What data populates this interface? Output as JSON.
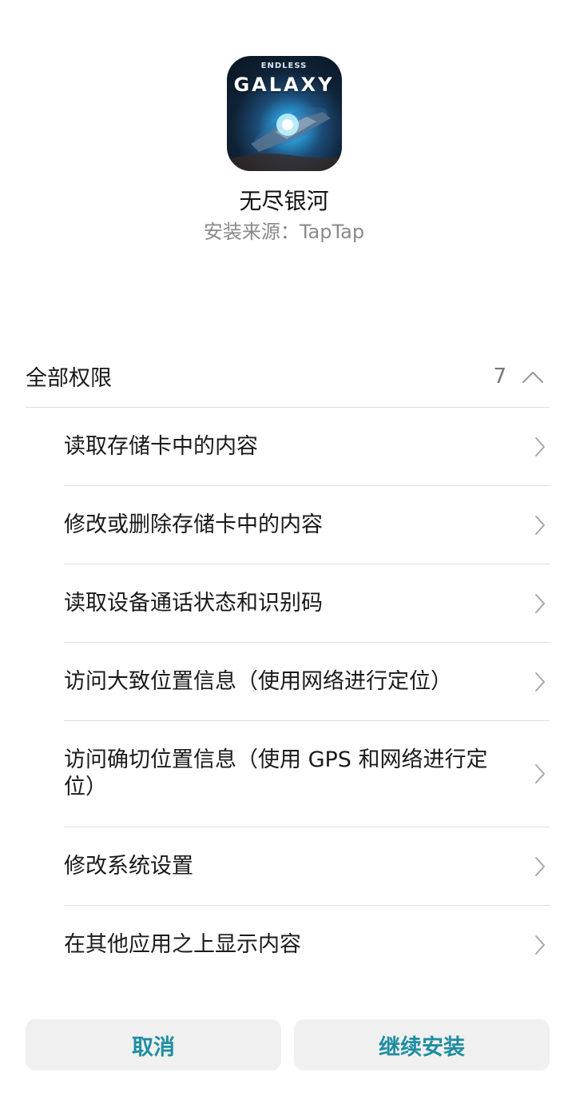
{
  "app": {
    "icon_name": "endless-galaxy-app-icon",
    "icon_text_small": "ENDLESS",
    "icon_text_big": "GALAXY",
    "name": "无尽银河",
    "source": "安装来源：TapTap"
  },
  "permissions": {
    "title": "全部权限",
    "count": "7",
    "items": [
      {
        "label": "读取存储卡中的内容"
      },
      {
        "label": "修改或删除存储卡中的内容"
      },
      {
        "label": "读取设备通话状态和识别码"
      },
      {
        "label": "访问大致位置信息（使用网络进行定位）"
      },
      {
        "label": "访问确切位置信息（使用 GPS 和网络进行定位）"
      },
      {
        "label": "修改系统设置"
      },
      {
        "label": "在其他应用之上显示内容"
      }
    ]
  },
  "buttons": {
    "cancel": "取消",
    "continue": "继续安装"
  },
  "colors": {
    "accent": "#1e8ea1",
    "button_bg": "#f0f0f0",
    "divider": "#dedede"
  }
}
